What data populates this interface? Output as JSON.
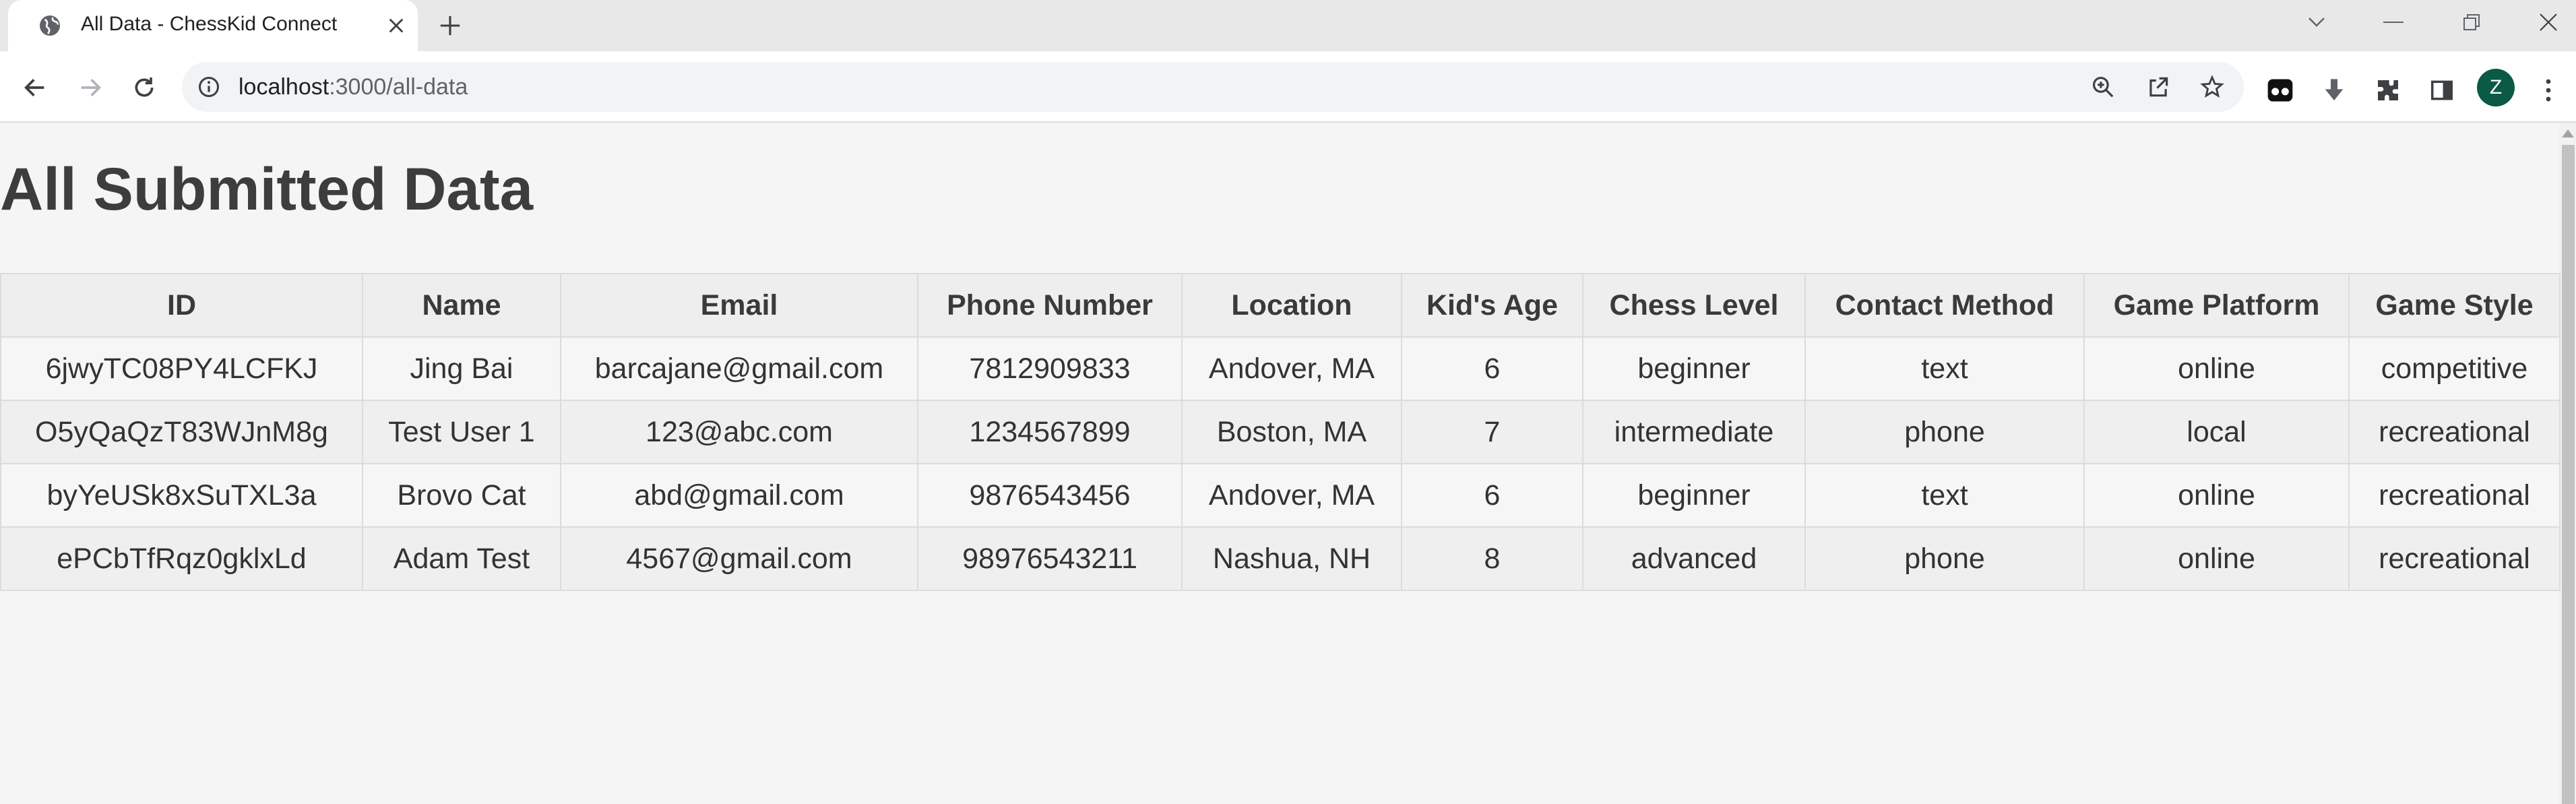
{
  "browser": {
    "tab": {
      "title": "All Data - ChessKid Connect"
    },
    "url": {
      "host": "localhost",
      "path": ":3000/all-data"
    },
    "profile_initial": "Z",
    "colors": {
      "profile": "#0b5a45",
      "tab_strip": "#e8e8e8"
    }
  },
  "page": {
    "title": "All Submitted Data",
    "table": {
      "headers": [
        "ID",
        "Name",
        "Email",
        "Phone Number",
        "Location",
        "Kid's Age",
        "Chess Level",
        "Contact Method",
        "Game Platform",
        "Game Style"
      ],
      "rows": [
        [
          "6jwyTC08PY4LCFKJ",
          "Jing Bai",
          "barcajane@gmail.com",
          "7812909833",
          "Andover, MA",
          "6",
          "beginner",
          "text",
          "online",
          "competitive"
        ],
        [
          "O5yQaQzT83WJnM8g",
          "Test User 1",
          "123@abc.com",
          "1234567899",
          "Boston, MA",
          "7",
          "intermediate",
          "phone",
          "local",
          "recreational"
        ],
        [
          "byYeUSk8xSuTXL3a",
          "Brovo Cat",
          "abd@gmail.com",
          "9876543456",
          "Andover, MA",
          "6",
          "beginner",
          "text",
          "online",
          "recreational"
        ],
        [
          "ePCbTfRqz0gklxLd",
          "Adam Test",
          "4567@gmail.com",
          "98976543211",
          "Nashua, NH",
          "8",
          "advanced",
          "phone",
          "online",
          "recreational"
        ]
      ]
    }
  }
}
